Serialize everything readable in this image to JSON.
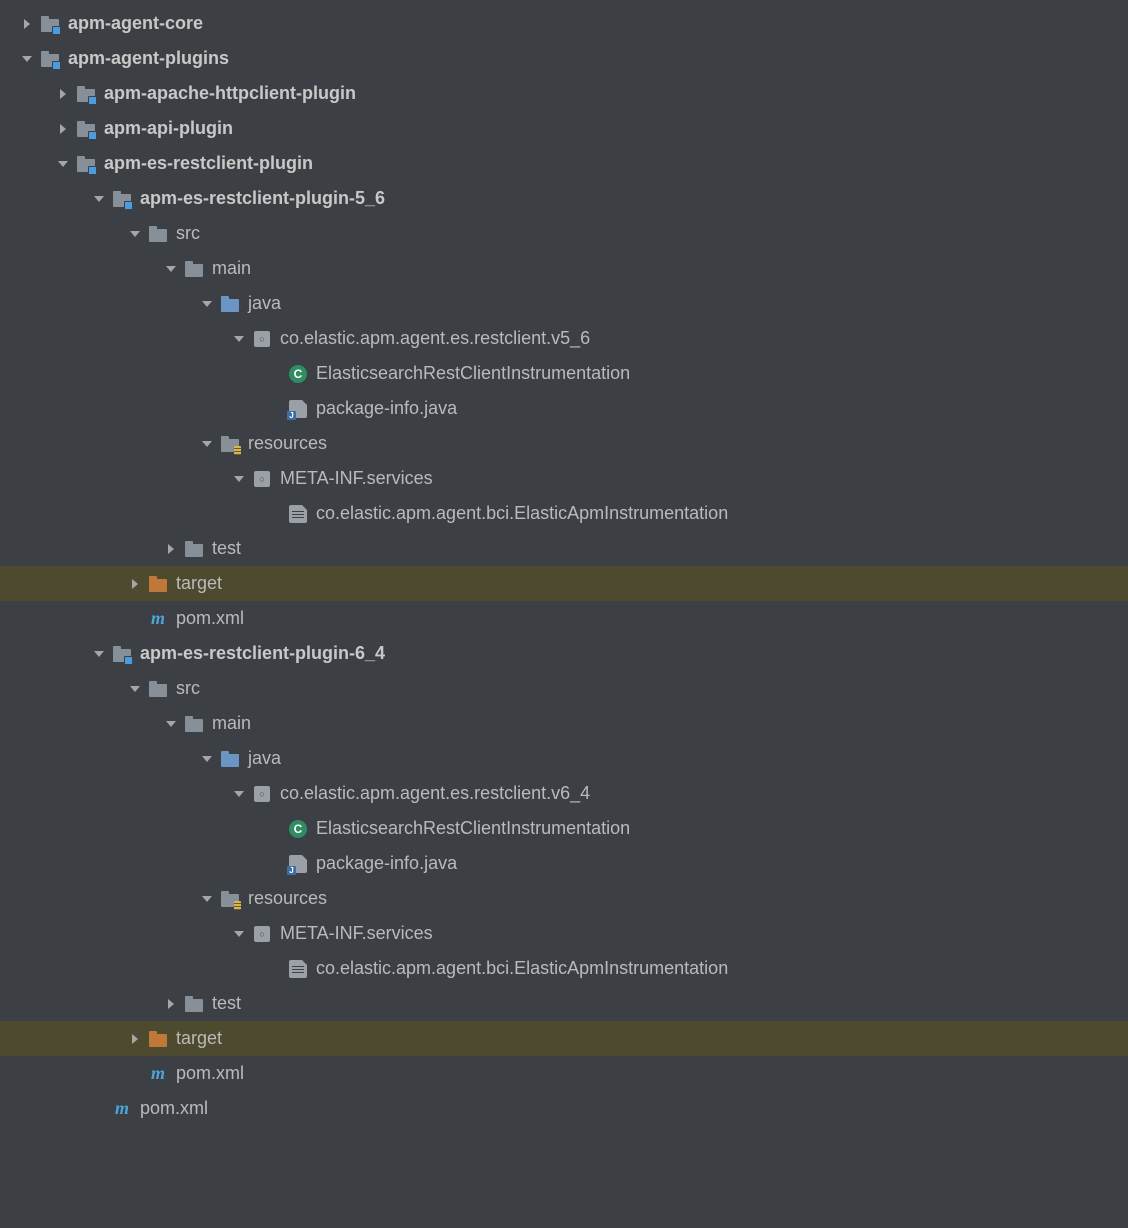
{
  "rows": [
    {
      "indent": 0,
      "arrow": "right",
      "icon": "module",
      "label": "apm-agent-core",
      "bold": true,
      "hl": false
    },
    {
      "indent": 0,
      "arrow": "down",
      "icon": "module",
      "label": "apm-agent-plugins",
      "bold": true,
      "hl": false
    },
    {
      "indent": 1,
      "arrow": "right",
      "icon": "module",
      "label": "apm-apache-httpclient-plugin",
      "bold": true,
      "hl": false
    },
    {
      "indent": 1,
      "arrow": "right",
      "icon": "module",
      "label": "apm-api-plugin",
      "bold": true,
      "hl": false
    },
    {
      "indent": 1,
      "arrow": "down",
      "icon": "module",
      "label": "apm-es-restclient-plugin",
      "bold": true,
      "hl": false
    },
    {
      "indent": 2,
      "arrow": "down",
      "icon": "module",
      "label": "apm-es-restclient-plugin-5_6",
      "bold": true,
      "hl": false
    },
    {
      "indent": 3,
      "arrow": "down",
      "icon": "folder",
      "label": "src",
      "bold": false,
      "hl": false
    },
    {
      "indent": 4,
      "arrow": "down",
      "icon": "folder",
      "label": "main",
      "bold": false,
      "hl": false
    },
    {
      "indent": 5,
      "arrow": "down",
      "icon": "folder-blue",
      "label": "java",
      "bold": false,
      "hl": false
    },
    {
      "indent": 6,
      "arrow": "down",
      "icon": "package",
      "label": "co.elastic.apm.agent.es.restclient.v5_6",
      "bold": false,
      "hl": false
    },
    {
      "indent": 7,
      "arrow": "blank",
      "icon": "class",
      "label": "ElasticsearchRestClientInstrumentation",
      "bold": false,
      "hl": false
    },
    {
      "indent": 7,
      "arrow": "blank",
      "icon": "jfile",
      "label": "package-info.java",
      "bold": false,
      "hl": false
    },
    {
      "indent": 5,
      "arrow": "down",
      "icon": "folder-res",
      "label": "resources",
      "bold": false,
      "hl": false
    },
    {
      "indent": 6,
      "arrow": "down",
      "icon": "package",
      "label": "META-INF.services",
      "bold": false,
      "hl": false
    },
    {
      "indent": 7,
      "arrow": "blank",
      "icon": "txtfile",
      "label": "co.elastic.apm.agent.bci.ElasticApmInstrumentation",
      "bold": false,
      "hl": false
    },
    {
      "indent": 4,
      "arrow": "right",
      "icon": "folder",
      "label": "test",
      "bold": false,
      "hl": false
    },
    {
      "indent": 3,
      "arrow": "right",
      "icon": "folder-orange",
      "label": "target",
      "bold": false,
      "hl": true
    },
    {
      "indent": 3,
      "arrow": "blank",
      "icon": "maven",
      "label": "pom.xml",
      "bold": false,
      "hl": false
    },
    {
      "indent": 2,
      "arrow": "down",
      "icon": "module",
      "label": "apm-es-restclient-plugin-6_4",
      "bold": true,
      "hl": false
    },
    {
      "indent": 3,
      "arrow": "down",
      "icon": "folder",
      "label": "src",
      "bold": false,
      "hl": false
    },
    {
      "indent": 4,
      "arrow": "down",
      "icon": "folder",
      "label": "main",
      "bold": false,
      "hl": false
    },
    {
      "indent": 5,
      "arrow": "down",
      "icon": "folder-blue",
      "label": "java",
      "bold": false,
      "hl": false
    },
    {
      "indent": 6,
      "arrow": "down",
      "icon": "package",
      "label": "co.elastic.apm.agent.es.restclient.v6_4",
      "bold": false,
      "hl": false
    },
    {
      "indent": 7,
      "arrow": "blank",
      "icon": "class",
      "label": "ElasticsearchRestClientInstrumentation",
      "bold": false,
      "hl": false
    },
    {
      "indent": 7,
      "arrow": "blank",
      "icon": "jfile",
      "label": "package-info.java",
      "bold": false,
      "hl": false
    },
    {
      "indent": 5,
      "arrow": "down",
      "icon": "folder-res",
      "label": "resources",
      "bold": false,
      "hl": false
    },
    {
      "indent": 6,
      "arrow": "down",
      "icon": "package",
      "label": "META-INF.services",
      "bold": false,
      "hl": false
    },
    {
      "indent": 7,
      "arrow": "blank",
      "icon": "txtfile",
      "label": "co.elastic.apm.agent.bci.ElasticApmInstrumentation",
      "bold": false,
      "hl": false
    },
    {
      "indent": 4,
      "arrow": "right",
      "icon": "folder",
      "label": "test",
      "bold": false,
      "hl": false
    },
    {
      "indent": 3,
      "arrow": "right",
      "icon": "folder-orange",
      "label": "target",
      "bold": false,
      "hl": true
    },
    {
      "indent": 3,
      "arrow": "blank",
      "icon": "maven",
      "label": "pom.xml",
      "bold": false,
      "hl": false
    },
    {
      "indent": 2,
      "arrow": "blank",
      "icon": "maven",
      "label": "pom.xml",
      "bold": false,
      "hl": false
    }
  ]
}
